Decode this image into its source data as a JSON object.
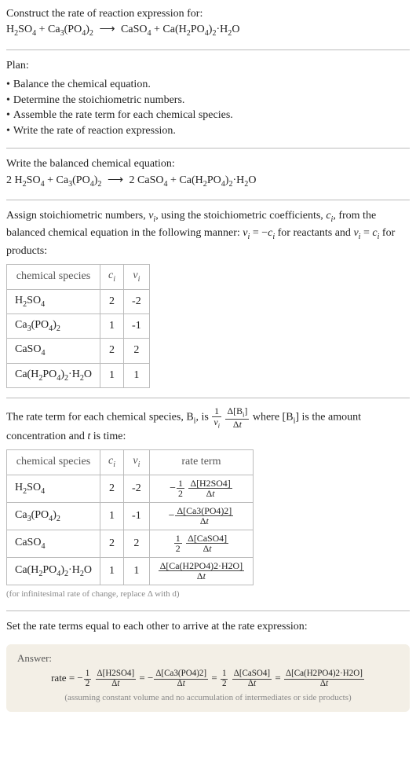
{
  "prompt_title": "Construct the rate of reaction expression for:",
  "plan_title": "Plan:",
  "plan_items": [
    "Balance the chemical equation.",
    "Determine the stoichiometric numbers.",
    "Assemble the rate term for each chemical species.",
    "Write the rate of reaction expression."
  ],
  "balanced_title": "Write the balanced chemical equation:",
  "assign_text_1": "Assign stoichiometric numbers, ",
  "assign_text_2": ", using the stoichiometric coefficients, ",
  "assign_text_3": ", from the balanced chemical equation in the following manner: ",
  "assign_text_4": " for reactants and ",
  "assign_text_5": " for products:",
  "nu_i": "ν",
  "nu_i_sub": "i",
  "c_i": "c",
  "c_i_sub": "i",
  "table1": {
    "headers": [
      "chemical species",
      "cᵢ",
      "νᵢ"
    ],
    "rows": [
      {
        "sp": "H2SO4",
        "c": "2",
        "v": "-2"
      },
      {
        "sp": "Ca3(PO4)2",
        "c": "1",
        "v": "-1"
      },
      {
        "sp": "CaSO4",
        "c": "2",
        "v": "2"
      },
      {
        "sp": "Ca(H2PO4)2·H2O",
        "c": "1",
        "v": "1"
      }
    ]
  },
  "rateterm_text_1": "The rate term for each chemical species, B",
  "rateterm_text_2": ", is ",
  "rateterm_text_3": " where [B",
  "rateterm_text_4": "] is the amount concentration and ",
  "rateterm_text_5": " is time:",
  "t_var": "t",
  "table2": {
    "headers": [
      "chemical species",
      "cᵢ",
      "νᵢ",
      "rate term"
    ]
  },
  "footnote": "(for infinitesimal rate of change, replace Δ with d)",
  "set_equal": "Set the rate terms equal to each other to arrive at the rate expression:",
  "answer_label": "Answer:",
  "rate_prefix": "rate = ",
  "answer_note": "(assuming constant volume and no accumulation of intermediates or side products)",
  "chart_data": {
    "type": "table",
    "title": "Stoichiometric numbers and rate terms",
    "series": [
      {
        "name": "stoichiometric",
        "columns": [
          "chemical species",
          "c_i",
          "nu_i"
        ],
        "rows": [
          [
            "H2SO4",
            2,
            -2
          ],
          [
            "Ca3(PO4)2",
            1,
            -1
          ],
          [
            "CaSO4",
            2,
            2
          ],
          [
            "Ca(H2PO4)2·H2O",
            1,
            1
          ]
        ]
      },
      {
        "name": "rate terms",
        "columns": [
          "chemical species",
          "c_i",
          "nu_i",
          "rate term"
        ],
        "rows": [
          [
            "H2SO4",
            2,
            -2,
            "-(1/2) Δ[H2SO4]/Δt"
          ],
          [
            "Ca3(PO4)2",
            1,
            -1,
            "- Δ[Ca3(PO4)2]/Δt"
          ],
          [
            "CaSO4",
            2,
            2,
            "(1/2) Δ[CaSO4]/Δt"
          ],
          [
            "Ca(H2PO4)2·H2O",
            1,
            1,
            "Δ[Ca(H2PO4)2·H2O]/Δt"
          ]
        ]
      }
    ],
    "unbalanced_equation": "H2SO4 + Ca3(PO4)2 → CaSO4 + Ca(H2PO4)2·H2O",
    "balanced_equation": "2 H2SO4 + Ca3(PO4)2 → 2 CaSO4 + Ca(H2PO4)2·H2O",
    "rate_expression": "rate = -(1/2) Δ[H2SO4]/Δt = - Δ[Ca3(PO4)2]/Δt = (1/2) Δ[CaSO4]/Δt = Δ[Ca(H2PO4)2·H2O]/Δt"
  }
}
